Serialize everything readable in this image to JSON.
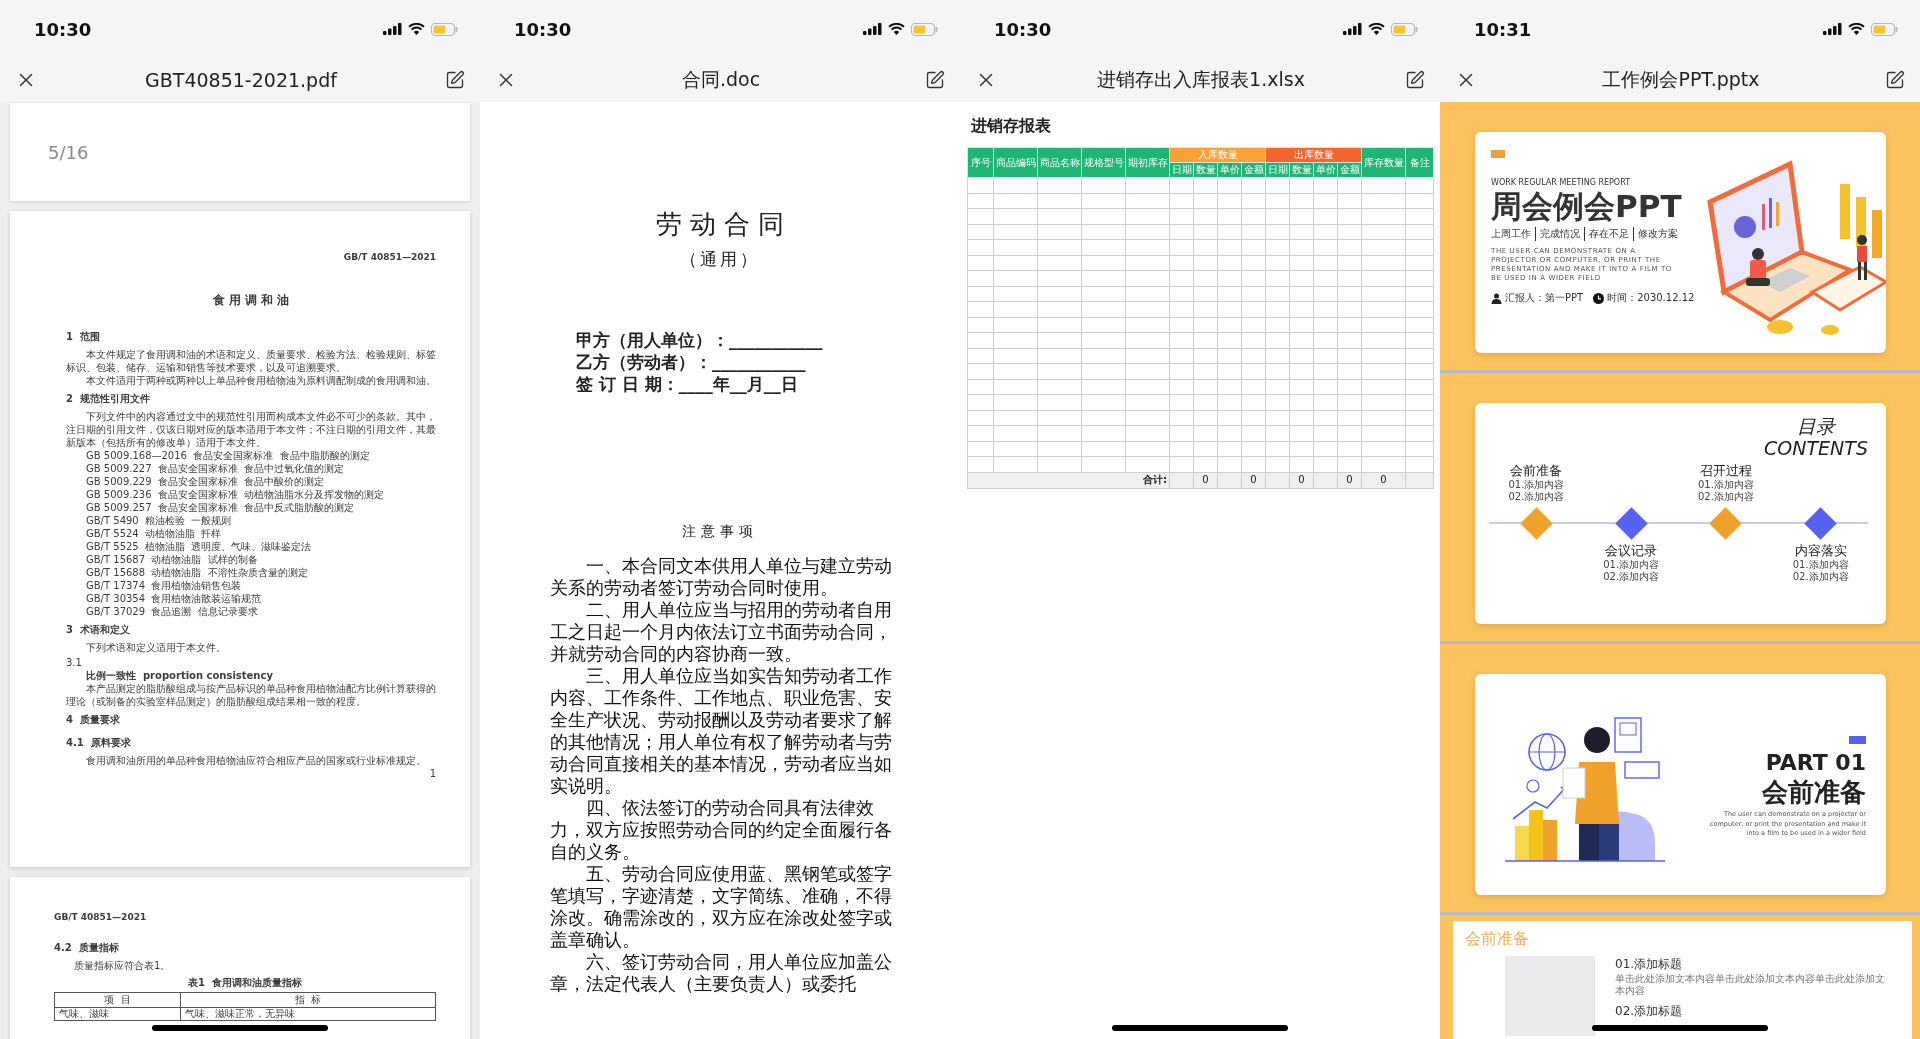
{
  "screens": [
    {
      "kind": "pdf",
      "time": "10:30",
      "title": "GBT40851-2021.pdf",
      "page_indicator": "5/16",
      "pages": [
        {
          "blocks": [
            {
              "kind": "code_right",
              "text": "GB/T 40851—2021"
            },
            {
              "kind": "title",
              "text": "食 用 调 和 油"
            },
            {
              "kind": "heading",
              "text": "1  范围"
            },
            {
              "kind": "para",
              "text": "本文件规定了食用调和油的术语和定义、质量要求、检验方法、检验规则、标签标识、包装、储存、运输和销售等技术要求，以及可追溯要求。"
            },
            {
              "kind": "para",
              "text": "本文件适用于两种或两种以上单品种食用植物油为原料调配制成的食用调和油。"
            },
            {
              "kind": "heading",
              "text": "2  规范性引用文件"
            },
            {
              "kind": "para",
              "text": "下列文件中的内容通过文中的规范性引用而构成本文件必不可少的条款。其中，注日期的引用文件，仅该日期对应的版本适用于本文件；不注日期的引用文件，其最新版本（包括所有的修改单）适用于本文件。"
            },
            {
              "kind": "ref",
              "text": "GB 5009.168—2016  食品安全国家标准  食品中脂肪酸的测定"
            },
            {
              "kind": "ref",
              "text": "GB 5009.227  食品安全国家标准  食品中过氧化值的测定"
            },
            {
              "kind": "ref",
              "text": "GB 5009.229  食品安全国家标准  食品中酸价的测定"
            },
            {
              "kind": "ref",
              "text": "GB 5009.236  食品安全国家标准  动植物油脂水分及挥发物的测定"
            },
            {
              "kind": "ref",
              "text": "GB 5009.257  食品安全国家标准  食品中反式脂肪酸的测定"
            },
            {
              "kind": "ref",
              "text": "GB/T 5490  粮油检验  一般规则"
            },
            {
              "kind": "ref",
              "text": "GB/T 5524  动植物油脂  扦样"
            },
            {
              "kind": "ref",
              "text": "GB/T 5525  植物油脂  透明度、气味、滋味鉴定法"
            },
            {
              "kind": "ref",
              "text": "GB/T 15687  动植物油脂  试样的制备"
            },
            {
              "kind": "ref",
              "text": "GB/T 15688  动植物油脂  不溶性杂质含量的测定"
            },
            {
              "kind": "ref",
              "text": "GB/T 17374  食用植物油销售包装"
            },
            {
              "kind": "ref",
              "text": "GB/T 30354  食用植物油散装运输规范"
            },
            {
              "kind": "ref",
              "text": "GB/T 37029  食品追溯  信息记录要求"
            },
            {
              "kind": "heading",
              "text": "3  术语和定义"
            },
            {
              "kind": "para",
              "text": "下列术语和定义适用于本文件。"
            },
            {
              "kind": "label",
              "text": "3.1"
            },
            {
              "kind": "term",
              "text": "比例一致性  proportion consistency"
            },
            {
              "kind": "para",
              "text": "本产品测定的脂肪酸组成与按产品标识的单品种食用植物油配方比例计算获得的理论（或制备的实验室样品测定）的脂肪酸组成结果相一致的程度。"
            },
            {
              "kind": "heading",
              "text": "4  质量要求"
            },
            {
              "kind": "heading",
              "text": "4.1  原料要求"
            },
            {
              "kind": "para",
              "text": "食用调和油所用的单品种食用植物油应符合相应产品的国家或行业标准规定。"
            },
            {
              "kind": "pagenum",
              "text": "1"
            }
          ]
        },
        {
          "blocks": [
            {
              "kind": "code_left",
              "text": "GB/T 40851—2021"
            },
            {
              "kind": "heading",
              "text": "4.2  质量指标"
            },
            {
              "kind": "para",
              "text": "质量指标应符合表1。"
            },
            {
              "kind": "caption",
              "text": "表1  食用调和油质量指标"
            },
            {
              "kind": "table",
              "columns": [
                "项  目",
                "指  标"
              ],
              "rows": [
                [
                  "气味、滋味",
                  "气味、滋味正常，无异味"
                ]
              ]
            }
          ]
        }
      ]
    },
    {
      "kind": "doc",
      "time": "10:30",
      "title": "合同.doc",
      "doc_title": "劳动合同",
      "doc_subtitle": "（通用）",
      "fields": [
        "甲方（用人单位）：___________",
        "乙方（劳动者）：___________",
        "签 订 日 期：____年__月__日"
      ],
      "notice_title": "注意事项",
      "paragraphs": [
        "一、本合同文本供用人单位与建立劳动关系的劳动者签订劳动合同时使用。",
        "二、用人单位应当与招用的劳动者自用工之日起一个月内依法订立书面劳动合同，并就劳动合同的内容协商一致。",
        "三、用人单位应当如实告知劳动者工作内容、工作条件、工作地点、职业危害、安全生产状况、劳动报酬以及劳动者要求了解的其他情况；用人单位有权了解劳动者与劳动合同直接相关的基本情况，劳动者应当如实说明。",
        "四、依法签订的劳动合同具有法律效力，双方应按照劳动合同的约定全面履行各自的义务。",
        "五、劳动合同应使用蓝、黑钢笔或签字笔填写，字迹清楚，文字简练、准确，不得涂改。确需涂改的，双方应在涂改处签字或盖章确认。",
        "六、签订劳动合同，用人单位应加盖公章，法定代表人（主要负责人）或委托"
      ]
    },
    {
      "kind": "sheet",
      "time": "10:30",
      "title": "进销存出入库报表1.xlsx",
      "sheet_title": "进销存报表",
      "total_label": "合计:",
      "columns": [
        {
          "label": "序号"
        },
        {
          "label": "商品编码"
        },
        {
          "label": "商品名称"
        },
        {
          "label": "规格型号"
        },
        {
          "label": "期初库存"
        },
        {
          "group": "入库数量",
          "color": "#f7a233",
          "subs": [
            {
              "label": "日期"
            },
            {
              "label": "数量",
              "total": "0"
            },
            {
              "label": "单价"
            },
            {
              "label": "金额",
              "total": "0"
            }
          ]
        },
        {
          "group": "出库数量",
          "color": "#f4652d",
          "subs": [
            {
              "label": "日期"
            },
            {
              "label": "数量",
              "total": "0"
            },
            {
              "label": "单价"
            },
            {
              "label": "金额",
              "total": "0"
            }
          ]
        },
        {
          "label": "库存数量",
          "total": "0"
        },
        {
          "label": "备注"
        }
      ]
    },
    {
      "kind": "slides",
      "time": "10:31",
      "title": "工作例会PPT.pptx",
      "slides": [
        {
          "kind": "cover",
          "label": "WORK REGULAR MEETING REPORT",
          "title": "周会例会PPT",
          "topics": [
            "上周工作",
            "完成情况",
            "存在不足",
            "修改方案"
          ],
          "blurb": "THE USER CAN DEMONSTRATE ON A PROJECTOR OR COMPUTER, OR PRINT THE PRESENTATION AND MAKE IT INTO A FILM TO BE USED IN A WIDER FIELD",
          "reporter": "汇报人：第一PPT",
          "date": "时间：2030.12.12"
        },
        {
          "kind": "contents",
          "title": "目录",
          "subtitle": "CONTENTS",
          "items": [
            {
              "title": "会前准备",
              "lines": [
                "01.添加内容",
                "02.添加内容"
              ],
              "color": "#f0a12a"
            },
            {
              "title": "会议记录",
              "lines": [
                "01.添加内容",
                "02.添加内容"
              ],
              "color": "#5662f0"
            },
            {
              "title": "召开过程",
              "lines": [
                "01.添加内容",
                "02.添加内容"
              ],
              "color": "#f0a12a"
            },
            {
              "title": "内容落实",
              "lines": [
                "01.添加内容",
                "02.添加内容"
              ],
              "color": "#5662f0"
            }
          ]
        },
        {
          "kind": "section",
          "part": "PART 01",
          "title": "会前准备",
          "blurb": "The user can demonstrate on a projector or computer, or print the presentation and make it into a film to be used in a wider field"
        },
        {
          "kind": "content",
          "title": "会前准备",
          "points": [
            {
              "title": "01.添加标题",
              "text": "单击此处添加文本内容单击此处添加文本内容单击此处添加文本内容"
            },
            {
              "title": "02.添加标题"
            }
          ]
        }
      ]
    }
  ]
}
